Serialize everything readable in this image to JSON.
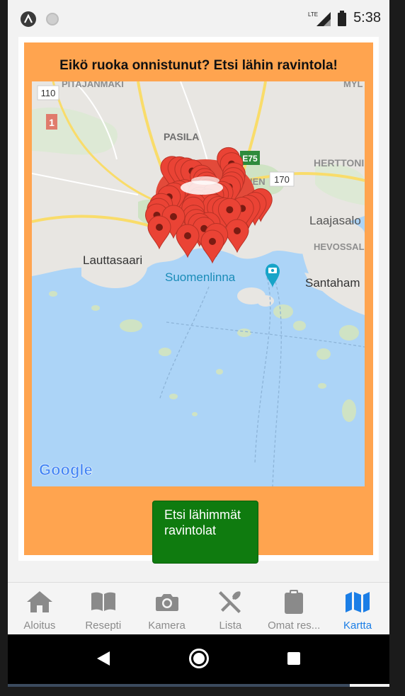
{
  "status": {
    "network": "LTE",
    "time": "5:38"
  },
  "card": {
    "title": "Eikö ruoka onnistunut? Etsi lähin ravintola!",
    "button_label": "Etsi lähimmät ravintolat"
  },
  "map": {
    "attribution": "Google",
    "labels": {
      "pitajanmaki": "PITAJANMAKI",
      "myl": "MYL",
      "pasila": "PASILA",
      "e75": "E75",
      "herttoniemi": "HERTTONIEMI",
      "road_170": "170",
      "road_110": "110",
      "road_1": "1",
      "laajasalo": "Laajasalo",
      "hevossalmi": "HEVOSSAL",
      "lauttasaari": "Lauttasaari",
      "suomenlinna": "Suomenlinna",
      "santahamina": "Santaham",
      "ien": "IEN"
    }
  },
  "tabs": [
    {
      "label": "Aloitus",
      "icon": "home-icon",
      "active": false
    },
    {
      "label": "Resepti",
      "icon": "book-icon",
      "active": false
    },
    {
      "label": "Kamera",
      "icon": "camera-icon",
      "active": false
    },
    {
      "label": "Lista",
      "icon": "utensils-icon",
      "active": false
    },
    {
      "label": "Omat res...",
      "icon": "clipboard-icon",
      "active": false
    },
    {
      "label": "Kartta",
      "icon": "map-icon",
      "active": true
    }
  ],
  "colors": {
    "card_bg": "#ffa44f",
    "button_bg": "#0f7b0f",
    "active_tab": "#1b7ee6",
    "marker": "#ea4335"
  }
}
